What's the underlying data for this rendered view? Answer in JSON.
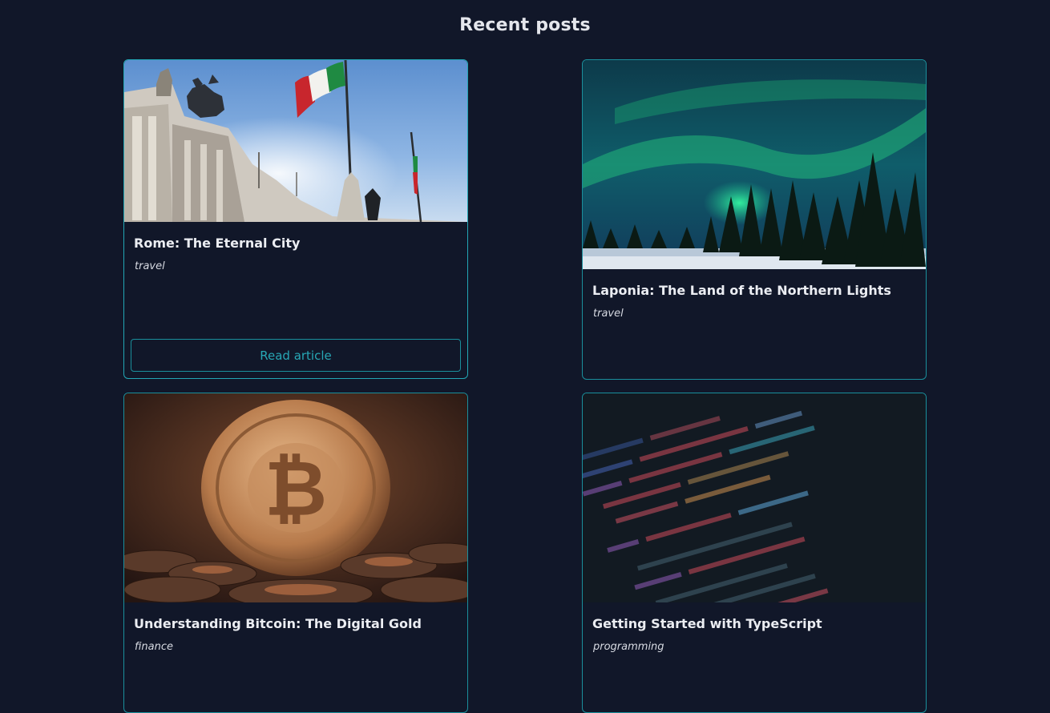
{
  "page": {
    "heading": "Recent posts"
  },
  "posts": [
    {
      "title": "Rome: The Eternal City",
      "category": "travel",
      "image": "rome-monument-with-italian-flags",
      "button_label": "Read article"
    },
    {
      "title": "Laponia: The Land of the Northern Lights",
      "category": "travel",
      "image": "aurora-over-pine-forest"
    },
    {
      "title": "Understanding Bitcoin: The Digital Gold",
      "category": "finance",
      "image": "bitcoin-coin-on-pile"
    },
    {
      "title": "Getting Started with TypeScript",
      "category": "programming",
      "image": "code-on-screen"
    }
  ],
  "colors": {
    "background": "#111729",
    "accent": "#1a8f9c",
    "text": "#ebedf2"
  }
}
